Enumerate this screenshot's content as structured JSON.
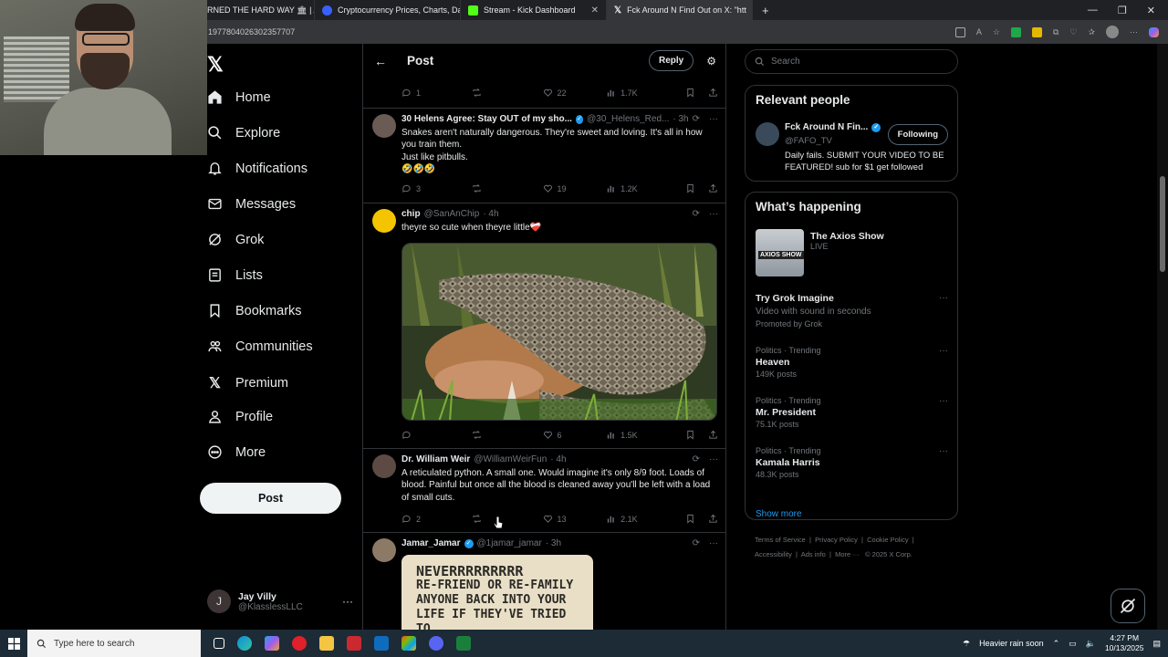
{
  "browser": {
    "tabs": [
      {
        "title": "RNED THE HARD WAY 🏛 | A",
        "color": "#e25c2b"
      },
      {
        "title": "Cryptocurrency Prices, Charts, Da",
        "color": "#3861fb"
      },
      {
        "title": "Stream - Kick Dashboard",
        "color": "#53fc18"
      },
      {
        "title": "Fck Around N Find Out on X: \"htt",
        "color": "#000000"
      }
    ],
    "url": "1977804026302357707"
  },
  "sidebar": {
    "items": [
      {
        "label": "Home"
      },
      {
        "label": "Explore"
      },
      {
        "label": "Notifications"
      },
      {
        "label": "Messages"
      },
      {
        "label": "Grok"
      },
      {
        "label": "Lists"
      },
      {
        "label": "Bookmarks"
      },
      {
        "label": "Communities"
      },
      {
        "label": "Premium"
      },
      {
        "label": "Profile"
      },
      {
        "label": "More"
      }
    ],
    "post_label": "Post",
    "account": {
      "name": "Jay Villy",
      "handle": "@KlasslessLLC",
      "initial": "J"
    }
  },
  "header": {
    "title": "Post",
    "reply_label": "Reply"
  },
  "tweets": [
    {
      "replies": "1",
      "reposts": "",
      "likes": "22",
      "views": "1.7K"
    },
    {
      "name": "30 Helens Agree: Stay OUT of my sho...",
      "handle": "@30_Helens_Red...",
      "time": "· 3h",
      "text1": "Snakes aren't naturally dangerous. They're sweet and loving. It's all in how you train them.",
      "text2": "Just like pitbulls.",
      "text3": "🤣🤣🤣",
      "replies": "3",
      "reposts": "",
      "likes": "19",
      "views": "1.2K"
    },
    {
      "name": "chip",
      "handle": "@SanAnChip",
      "time": "· 4h",
      "text1": "theyre so cute when theyre little❤️‍🩹",
      "replies": "",
      "reposts": "",
      "likes": "6",
      "views": "1.5K"
    },
    {
      "name": "Dr. William Weir",
      "handle": "@WilliamWeirFun",
      "time": "· 4h",
      "text1": "A reticulated python. A small one. Would imagine it's only 8/9 foot. Loads of blood. Painful but once all the blood is cleaned away you'll be left with a load of small cuts.",
      "replies": "2",
      "reposts": "",
      "likes": "13",
      "views": "2.1K"
    },
    {
      "name": "Jamar_Jamar",
      "handle": "@1jamar_jamar",
      "time": "· 3h",
      "sign_lines": [
        "NEVERRRRRRRRR",
        "RE-FRIEND OR RE-FAMILY",
        "ANYONE BACK INTO YOUR",
        "LIFE IF THEY'VE TRIED TO"
      ]
    }
  ],
  "right": {
    "search_placeholder": "Search",
    "relevant": {
      "title": "Relevant people",
      "name": "Fck Around N Fin...",
      "handle": "@FAFO_TV",
      "follow_label": "Following",
      "bio": "Daily fails. SUBMIT YOUR VIDEO TO BE FEATURED! sub for $1 get followed"
    },
    "happening": {
      "title": "What’s happening",
      "axios": {
        "title": "The Axios Show",
        "sub": "LIVE",
        "img_text": "AXIOS SHOW"
      },
      "promo": {
        "title": "Try Grok Imagine",
        "sub": "Video with sound in seconds",
        "tag": "Promoted by Grok"
      },
      "trends": [
        {
          "context": "Politics · Trending",
          "title": "Heaven",
          "posts": "149K posts"
        },
        {
          "context": "Politics · Trending",
          "title": "Mr. President",
          "posts": "75.1K posts"
        },
        {
          "context": "Politics · Trending",
          "title": "Kamala Harris",
          "posts": "48.3K posts"
        }
      ],
      "show_more": "Show more"
    },
    "footer": [
      "Terms of Service",
      "Privacy Policy",
      "Cookie Policy",
      "Accessibility",
      "Ads info",
      "More ···",
      "© 2025 X Corp."
    ]
  },
  "taskbar": {
    "search": "Type here to search",
    "weather": "Heavier rain soon",
    "time": "4:27 PM",
    "date": "10/13/2025"
  }
}
